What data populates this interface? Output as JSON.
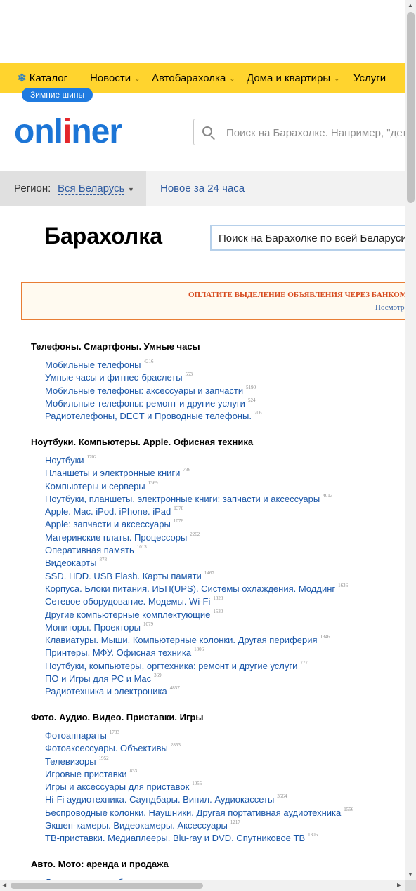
{
  "nav": {
    "items": [
      {
        "label": "Каталог",
        "icon": "snowflake-icon",
        "chevron": false
      },
      {
        "label": "Новости",
        "chevron": true
      },
      {
        "label": "Автобарахолка",
        "chevron": true
      },
      {
        "label": "Дома и квартиры",
        "chevron": true
      },
      {
        "label": "Услуги",
        "chevron": false
      }
    ],
    "promo_pill": "Зимние шины",
    "accent_color": "#ffd42e"
  },
  "header": {
    "logo_a": "onl",
    "logo_b": "i",
    "logo_c": "ner",
    "search_placeholder": "Поиск на Барахолке. Например, \"детские"
  },
  "region": {
    "label": "Регион:",
    "value": "Вся Беларусь",
    "new_link": "Новое за 24 часа"
  },
  "page": {
    "title": "Барахолка",
    "search_placeholder": "Поиск на Барахолке по всей Беларуси"
  },
  "notice": {
    "text": "ОПЛАТИТЕ ВЫДЕЛЕНИЕ ОБЪЯВЛЕНИЯ ЧЕРЕЗ БАНКОМ",
    "link": "Посмотре"
  },
  "categories": [
    {
      "title": "Телефоны. Смартфоны. Умные часы",
      "items": [
        {
          "label": "Мобильные телефоны",
          "count": "4216"
        },
        {
          "label": "Умные часы и фитнес-браслеты",
          "count": "553"
        },
        {
          "label": "Мобильные телефоны: аксессуары и запчасти",
          "count": "5190"
        },
        {
          "label": "Мобильные телефоны: ремонт и другие услуги",
          "count": "524"
        },
        {
          "label": "Радиотелефоны, DECT и Проводные телефоны.",
          "count": "706"
        }
      ]
    },
    {
      "title": "Ноутбуки. Компьютеры. Apple. Офисная техника",
      "items": [
        {
          "label": "Ноутбуки",
          "count": "1702"
        },
        {
          "label": "Планшеты и электронные книги",
          "count": "736"
        },
        {
          "label": "Компьютеры и серверы",
          "count": "1369"
        },
        {
          "label": "Ноутбуки, планшеты, электронные книги: запчасти и аксессуары",
          "count": "4013"
        },
        {
          "label": "Apple. Mac. iPod. iPhone. iPad",
          "count": "1378"
        },
        {
          "label": "Apple: запчасти и аксессуары",
          "count": "1076"
        },
        {
          "label": "Материнские платы. Процессоры",
          "count": "2262"
        },
        {
          "label": "Оперативная память",
          "count": "1013"
        },
        {
          "label": "Видеокарты",
          "count": "878"
        },
        {
          "label": "SSD. HDD. USB Flash. Карты памяти",
          "count": "1467"
        },
        {
          "label": "Корпуса. Блоки питания. ИБП(UPS). Системы охлаждения. Моддинг",
          "count": "1636"
        },
        {
          "label": "Сетевое оборудование. Модемы. Wi-Fi",
          "count": "1828"
        },
        {
          "label": "Другие компьютерные комплектующие",
          "count": "1530"
        },
        {
          "label": "Мониторы. Проекторы",
          "count": "1079"
        },
        {
          "label": "Клавиатуры. Мыши. Компьютерные колонки. Другая периферия",
          "count": "1346"
        },
        {
          "label": "Принтеры. МФУ. Офисная техника",
          "count": "1806"
        },
        {
          "label": "Ноутбуки, компьютеры, оргтехника: ремонт и другие услуги",
          "count": "777"
        },
        {
          "label": "ПО и Игры для PC и Mac",
          "count": "369"
        },
        {
          "label": "Радиотехника и электроника",
          "count": "4857"
        }
      ]
    },
    {
      "title": "Фото. Аудио. Видео. Приставки. Игры",
      "items": [
        {
          "label": "Фотоаппараты",
          "count": "1783"
        },
        {
          "label": "Фотоаксессуары. Объективы",
          "count": "2853"
        },
        {
          "label": "Телевизоры",
          "count": "1952"
        },
        {
          "label": "Игровые приставки",
          "count": "833"
        },
        {
          "label": "Игры и аксессуары для приставок",
          "count": "1055"
        },
        {
          "label": "Hi-Fi аудиотехника. Саундбары. Винил. Аудиокассеты",
          "count": "3564"
        },
        {
          "label": "Беспроводные колонки. Наушники. Другая портативная аудиотехника",
          "count": "1556"
        },
        {
          "label": "Экшен-камеры. Видеокамеры. Аксессуары",
          "count": "1217"
        },
        {
          "label": "ТВ-приставки. Медиаплееры. Blu-ray и DVD. Спутниковое ТВ",
          "count": "1305"
        }
      ]
    },
    {
      "title": "Авто. Мото: аренда и продажа",
      "items": [
        {
          "label": "Легковые автомобили",
          "count": ""
        }
      ]
    }
  ]
}
